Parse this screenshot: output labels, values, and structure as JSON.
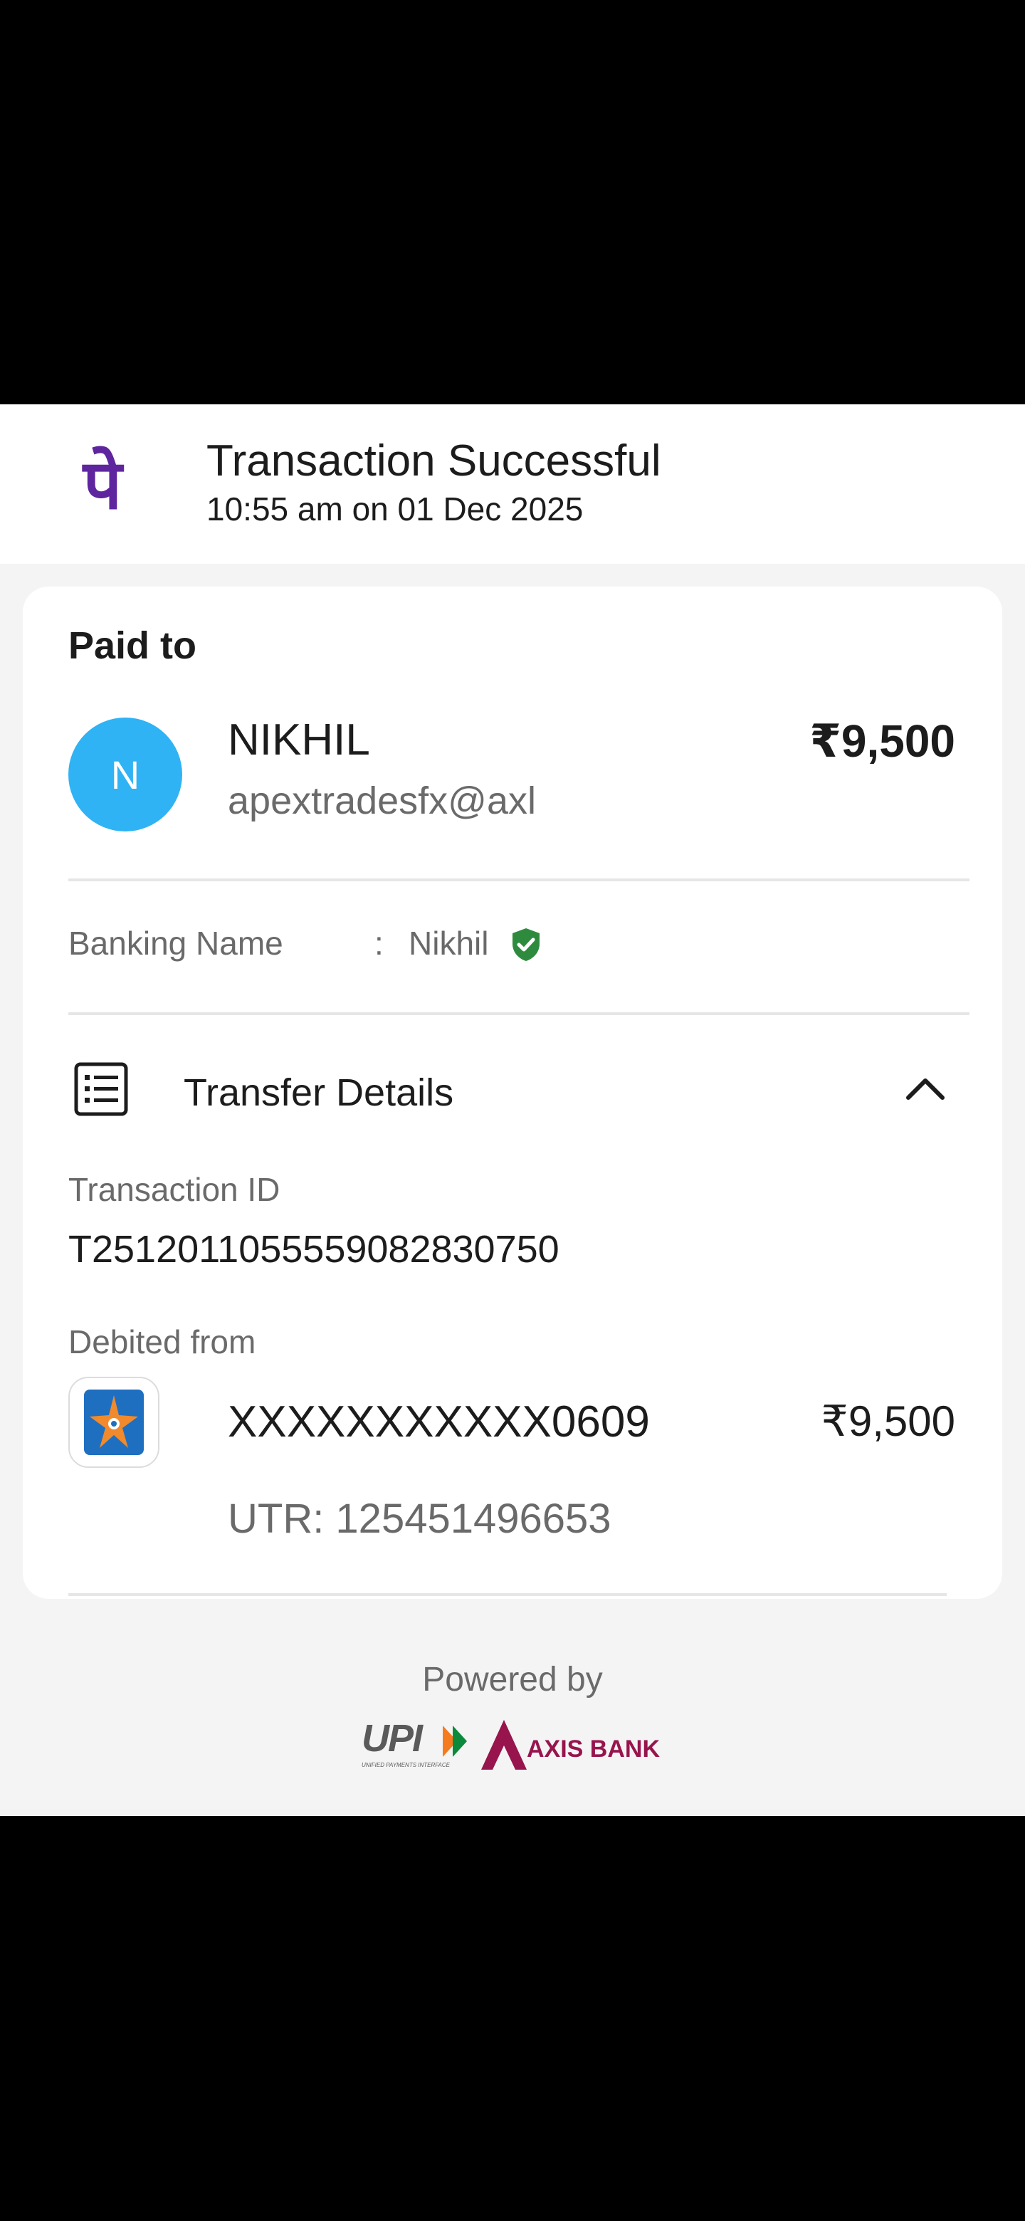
{
  "header": {
    "logo_glyph": "पे",
    "title": "Transaction Successful",
    "subtitle": "10:55 am on 01 Dec 2025",
    "brand_color": "#5f259f"
  },
  "paid_to": {
    "label": "Paid to",
    "avatar_initial": "N",
    "avatar_color": "#2fb3f4",
    "name": "NIKHIL",
    "vpa": "apextradesfx@axl",
    "amount": "₹9,500"
  },
  "banking_name": {
    "label": "Banking Name",
    "separator": ":",
    "value": "Nikhil",
    "verified_color": "#2e8b3e"
  },
  "transfer_details": {
    "title": "Transfer Details",
    "transaction_id_label": "Transaction ID",
    "transaction_id": "T2512011055559082830750",
    "debited_from_label": "Debited from",
    "account_number": "XXXXXXXXXXX0609",
    "debited_amount": "₹9,500",
    "utr": "UTR: 125451496653"
  },
  "footer": {
    "powered_by": "Powered by",
    "upi_text": "UPI",
    "upi_subtext": "UNIFIED PAYMENTS INTERFACE",
    "partner_bank": "AXIS BANK",
    "axis_color": "#97144d"
  }
}
